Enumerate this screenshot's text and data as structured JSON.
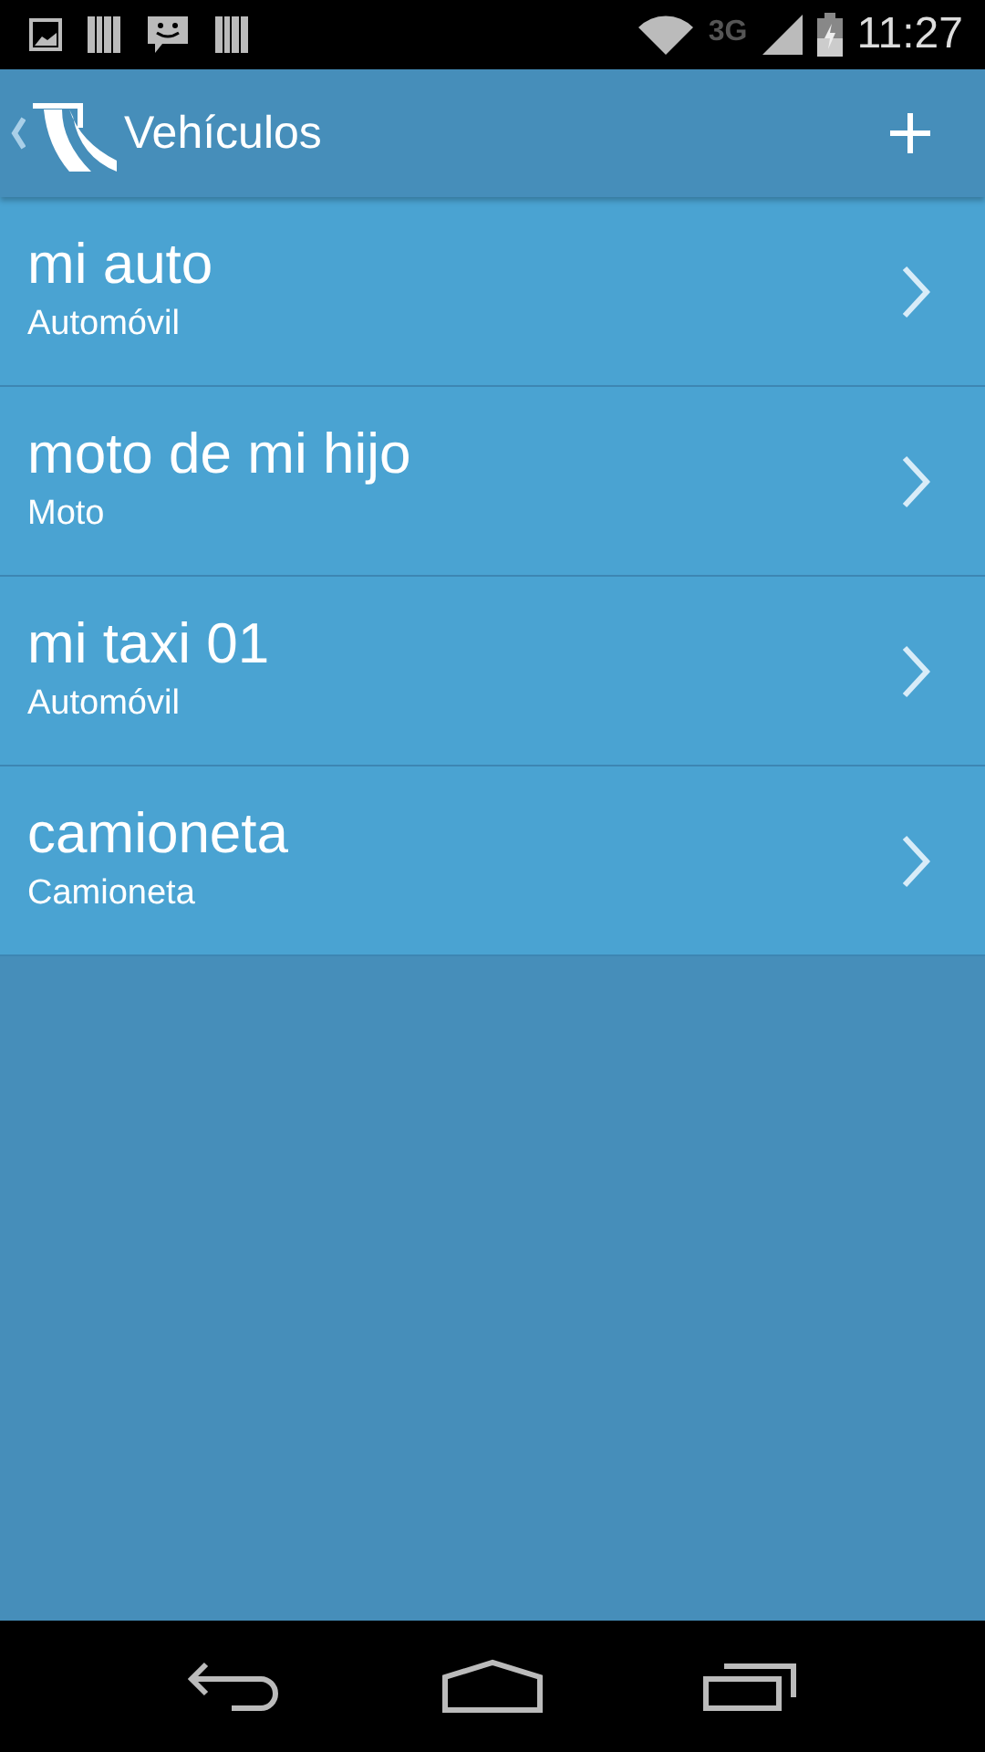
{
  "status_bar": {
    "network": "3G",
    "time": "11:27"
  },
  "app_bar": {
    "title": "Vehículos"
  },
  "vehicles": [
    {
      "name": "mi auto",
      "type": "Automóvil"
    },
    {
      "name": "moto de mi hijo",
      "type": "Moto"
    },
    {
      "name": "mi taxi 01",
      "type": "Automóvil"
    },
    {
      "name": "camioneta",
      "type": "Camioneta"
    }
  ]
}
